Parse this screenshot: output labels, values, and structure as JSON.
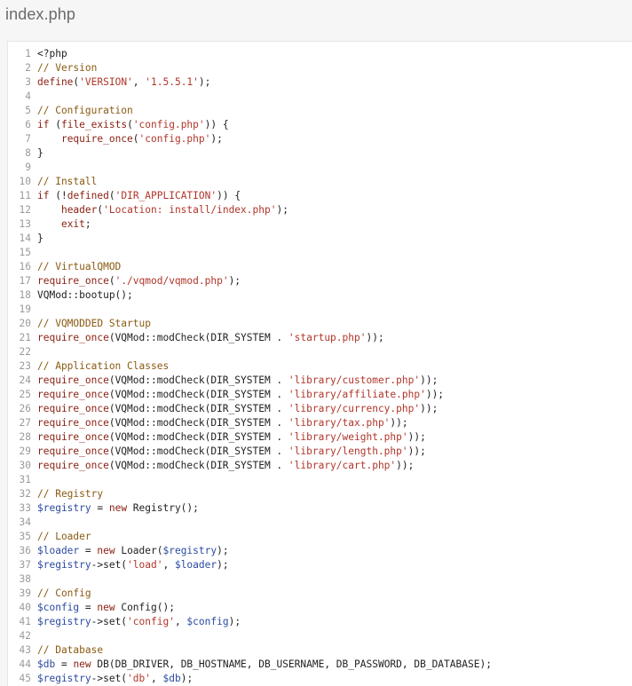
{
  "file": {
    "title": "index.php"
  },
  "colors": {
    "plain": "#222222",
    "keyword": "#8a1f11",
    "string": "#b0362a",
    "comment": "#8a5a12",
    "variable": "#2b4aa0",
    "line_number": "#9a9a9a"
  },
  "code_lines": [
    {
      "n": "1",
      "tokens": [
        {
          "t": "plain",
          "v": "<?php"
        }
      ]
    },
    {
      "n": "2",
      "tokens": [
        {
          "t": "comment",
          "v": "// Version"
        }
      ]
    },
    {
      "n": "3",
      "tokens": [
        {
          "t": "keyword",
          "v": "define"
        },
        {
          "t": "plain",
          "v": "("
        },
        {
          "t": "string",
          "v": "'VERSION'"
        },
        {
          "t": "plain",
          "v": ", "
        },
        {
          "t": "string",
          "v": "'1.5.5.1'"
        },
        {
          "t": "plain",
          "v": ");"
        }
      ]
    },
    {
      "n": "4",
      "tokens": []
    },
    {
      "n": "5",
      "tokens": [
        {
          "t": "comment",
          "v": "// Configuration"
        }
      ]
    },
    {
      "n": "6",
      "tokens": [
        {
          "t": "keyword",
          "v": "if"
        },
        {
          "t": "plain",
          "v": " ("
        },
        {
          "t": "keyword",
          "v": "file_exists"
        },
        {
          "t": "plain",
          "v": "("
        },
        {
          "t": "string",
          "v": "'config.php'"
        },
        {
          "t": "plain",
          "v": ")) {"
        }
      ]
    },
    {
      "n": "7",
      "tokens": [
        {
          "t": "plain",
          "v": "    "
        },
        {
          "t": "keyword",
          "v": "require_once"
        },
        {
          "t": "plain",
          "v": "("
        },
        {
          "t": "string",
          "v": "'config.php'"
        },
        {
          "t": "plain",
          "v": ");"
        }
      ]
    },
    {
      "n": "8",
      "tokens": [
        {
          "t": "plain",
          "v": "}"
        }
      ]
    },
    {
      "n": "9",
      "tokens": []
    },
    {
      "n": "10",
      "tokens": [
        {
          "t": "comment",
          "v": "// Install"
        }
      ]
    },
    {
      "n": "11",
      "tokens": [
        {
          "t": "keyword",
          "v": "if"
        },
        {
          "t": "plain",
          "v": " (!"
        },
        {
          "t": "keyword",
          "v": "defined"
        },
        {
          "t": "plain",
          "v": "("
        },
        {
          "t": "string",
          "v": "'DIR_APPLICATION'"
        },
        {
          "t": "plain",
          "v": ")) {"
        }
      ]
    },
    {
      "n": "12",
      "tokens": [
        {
          "t": "plain",
          "v": "    "
        },
        {
          "t": "keyword",
          "v": "header"
        },
        {
          "t": "plain",
          "v": "("
        },
        {
          "t": "string",
          "v": "'Location: install/index.php'"
        },
        {
          "t": "plain",
          "v": ");"
        }
      ]
    },
    {
      "n": "13",
      "tokens": [
        {
          "t": "plain",
          "v": "    "
        },
        {
          "t": "keyword",
          "v": "exit"
        },
        {
          "t": "plain",
          "v": ";"
        }
      ]
    },
    {
      "n": "14",
      "tokens": [
        {
          "t": "plain",
          "v": "}"
        }
      ]
    },
    {
      "n": "15",
      "tokens": []
    },
    {
      "n": "16",
      "tokens": [
        {
          "t": "comment",
          "v": "// VirtualQMOD"
        }
      ]
    },
    {
      "n": "17",
      "tokens": [
        {
          "t": "keyword",
          "v": "require_once"
        },
        {
          "t": "plain",
          "v": "("
        },
        {
          "t": "string",
          "v": "'./vqmod/vqmod.php'"
        },
        {
          "t": "plain",
          "v": ");"
        }
      ]
    },
    {
      "n": "18",
      "tokens": [
        {
          "t": "plain",
          "v": "VQMod::bootup();"
        }
      ]
    },
    {
      "n": "19",
      "tokens": []
    },
    {
      "n": "20",
      "tokens": [
        {
          "t": "comment",
          "v": "// VQMODDED Startup"
        }
      ]
    },
    {
      "n": "21",
      "tokens": [
        {
          "t": "keyword",
          "v": "require_once"
        },
        {
          "t": "plain",
          "v": "(VQMod::modCheck(DIR_SYSTEM . "
        },
        {
          "t": "string",
          "v": "'startup.php'"
        },
        {
          "t": "plain",
          "v": "));"
        }
      ]
    },
    {
      "n": "22",
      "tokens": []
    },
    {
      "n": "23",
      "tokens": [
        {
          "t": "comment",
          "v": "// Application Classes"
        }
      ]
    },
    {
      "n": "24",
      "tokens": [
        {
          "t": "keyword",
          "v": "require_once"
        },
        {
          "t": "plain",
          "v": "(VQMod::modCheck(DIR_SYSTEM . "
        },
        {
          "t": "string",
          "v": "'library/customer.php'"
        },
        {
          "t": "plain",
          "v": "));"
        }
      ]
    },
    {
      "n": "25",
      "tokens": [
        {
          "t": "keyword",
          "v": "require_once"
        },
        {
          "t": "plain",
          "v": "(VQMod::modCheck(DIR_SYSTEM . "
        },
        {
          "t": "string",
          "v": "'library/affiliate.php'"
        },
        {
          "t": "plain",
          "v": "));"
        }
      ]
    },
    {
      "n": "26",
      "tokens": [
        {
          "t": "keyword",
          "v": "require_once"
        },
        {
          "t": "plain",
          "v": "(VQMod::modCheck(DIR_SYSTEM . "
        },
        {
          "t": "string",
          "v": "'library/currency.php'"
        },
        {
          "t": "plain",
          "v": "));"
        }
      ]
    },
    {
      "n": "27",
      "tokens": [
        {
          "t": "keyword",
          "v": "require_once"
        },
        {
          "t": "plain",
          "v": "(VQMod::modCheck(DIR_SYSTEM . "
        },
        {
          "t": "string",
          "v": "'library/tax.php'"
        },
        {
          "t": "plain",
          "v": "));"
        }
      ]
    },
    {
      "n": "28",
      "tokens": [
        {
          "t": "keyword",
          "v": "require_once"
        },
        {
          "t": "plain",
          "v": "(VQMod::modCheck(DIR_SYSTEM . "
        },
        {
          "t": "string",
          "v": "'library/weight.php'"
        },
        {
          "t": "plain",
          "v": "));"
        }
      ]
    },
    {
      "n": "29",
      "tokens": [
        {
          "t": "keyword",
          "v": "require_once"
        },
        {
          "t": "plain",
          "v": "(VQMod::modCheck(DIR_SYSTEM . "
        },
        {
          "t": "string",
          "v": "'library/length.php'"
        },
        {
          "t": "plain",
          "v": "));"
        }
      ]
    },
    {
      "n": "30",
      "tokens": [
        {
          "t": "keyword",
          "v": "require_once"
        },
        {
          "t": "plain",
          "v": "(VQMod::modCheck(DIR_SYSTEM . "
        },
        {
          "t": "string",
          "v": "'library/cart.php'"
        },
        {
          "t": "plain",
          "v": "));"
        }
      ]
    },
    {
      "n": "31",
      "tokens": []
    },
    {
      "n": "32",
      "tokens": [
        {
          "t": "comment",
          "v": "// Registry"
        }
      ]
    },
    {
      "n": "33",
      "tokens": [
        {
          "t": "variable",
          "v": "$registry"
        },
        {
          "t": "plain",
          "v": " = "
        },
        {
          "t": "keyword",
          "v": "new"
        },
        {
          "t": "plain",
          "v": " Registry();"
        }
      ]
    },
    {
      "n": "34",
      "tokens": []
    },
    {
      "n": "35",
      "tokens": [
        {
          "t": "comment",
          "v": "// Loader"
        }
      ]
    },
    {
      "n": "36",
      "tokens": [
        {
          "t": "variable",
          "v": "$loader"
        },
        {
          "t": "plain",
          "v": " = "
        },
        {
          "t": "keyword",
          "v": "new"
        },
        {
          "t": "plain",
          "v": " Loader("
        },
        {
          "t": "variable",
          "v": "$registry"
        },
        {
          "t": "plain",
          "v": ");"
        }
      ]
    },
    {
      "n": "37",
      "tokens": [
        {
          "t": "variable",
          "v": "$registry"
        },
        {
          "t": "plain",
          "v": "->set("
        },
        {
          "t": "string",
          "v": "'load'"
        },
        {
          "t": "plain",
          "v": ", "
        },
        {
          "t": "variable",
          "v": "$loader"
        },
        {
          "t": "plain",
          "v": ");"
        }
      ]
    },
    {
      "n": "38",
      "tokens": []
    },
    {
      "n": "39",
      "tokens": [
        {
          "t": "comment",
          "v": "// Config"
        }
      ]
    },
    {
      "n": "40",
      "tokens": [
        {
          "t": "variable",
          "v": "$config"
        },
        {
          "t": "plain",
          "v": " = "
        },
        {
          "t": "keyword",
          "v": "new"
        },
        {
          "t": "plain",
          "v": " Config();"
        }
      ]
    },
    {
      "n": "41",
      "tokens": [
        {
          "t": "variable",
          "v": "$registry"
        },
        {
          "t": "plain",
          "v": "->set("
        },
        {
          "t": "string",
          "v": "'config'"
        },
        {
          "t": "plain",
          "v": ", "
        },
        {
          "t": "variable",
          "v": "$config"
        },
        {
          "t": "plain",
          "v": ");"
        }
      ]
    },
    {
      "n": "42",
      "tokens": []
    },
    {
      "n": "43",
      "tokens": [
        {
          "t": "comment",
          "v": "// Database"
        }
      ]
    },
    {
      "n": "44",
      "tokens": [
        {
          "t": "variable",
          "v": "$db"
        },
        {
          "t": "plain",
          "v": " = "
        },
        {
          "t": "keyword",
          "v": "new"
        },
        {
          "t": "plain",
          "v": " DB(DB_DRIVER, DB_HOSTNAME, DB_USERNAME, DB_PASSWORD, DB_DATABASE);"
        }
      ]
    },
    {
      "n": "45",
      "tokens": [
        {
          "t": "variable",
          "v": "$registry"
        },
        {
          "t": "plain",
          "v": "->set("
        },
        {
          "t": "string",
          "v": "'db'"
        },
        {
          "t": "plain",
          "v": ", "
        },
        {
          "t": "variable",
          "v": "$db"
        },
        {
          "t": "plain",
          "v": ");"
        }
      ]
    }
  ]
}
